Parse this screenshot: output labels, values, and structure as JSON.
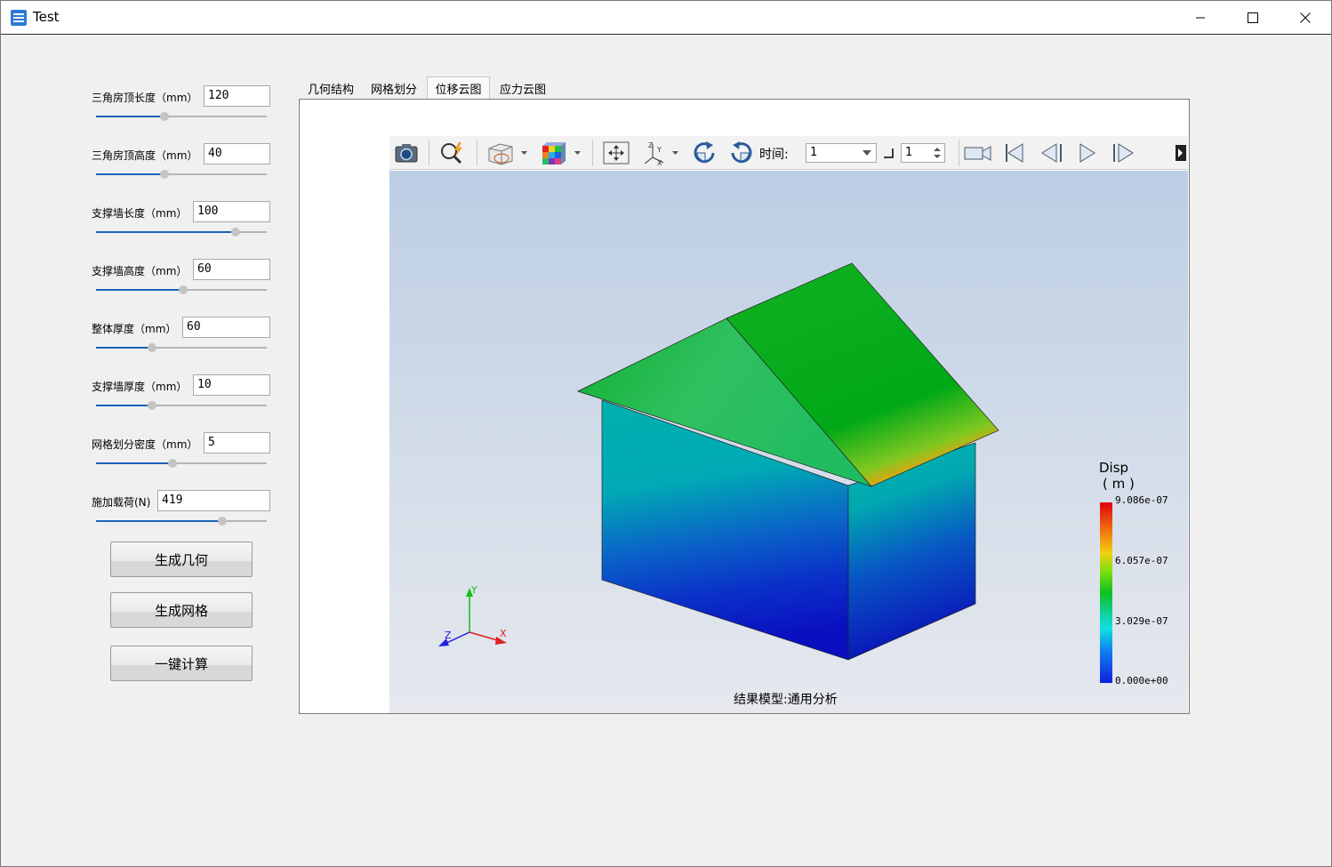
{
  "window": {
    "title": "Test",
    "minimize_icon": "minimize-icon",
    "maximize_icon": "maximize-icon",
    "close_icon": "close-icon"
  },
  "params": [
    {
      "label": "三角房顶长度（mm）",
      "value": "120",
      "slider_fraction": 0.4
    },
    {
      "label": "三角房顶高度（mm）",
      "value": "40",
      "slider_fraction": 0.4
    },
    {
      "label": "支撑墙长度（mm）",
      "value": "100",
      "slider_fraction": 0.82
    },
    {
      "label": "支撑墙高度（mm）",
      "value": "60",
      "slider_fraction": 0.51
    },
    {
      "label": "整体厚度（mm）",
      "value": "60",
      "slider_fraction": 0.33
    },
    {
      "label": "支撑墙厚度（mm）",
      "value": "10",
      "slider_fraction": 0.33
    },
    {
      "label": "网格划分密度（mm）",
      "value": "5",
      "slider_fraction": 0.45
    },
    {
      "label": "施加载荷(N)",
      "value": "419",
      "slider_fraction": 0.74
    }
  ],
  "buttons": {
    "generate_geometry": "生成几何",
    "generate_mesh": "生成网格",
    "one_click_compute": "一键计算"
  },
  "tabs": [
    {
      "label": "几何结构",
      "active": false
    },
    {
      "label": "网格划分",
      "active": false
    },
    {
      "label": "位移云图",
      "active": true
    },
    {
      "label": "应力云图",
      "active": false
    }
  ],
  "toolbar": {
    "time_label": "时间:",
    "time_value": "1",
    "step_value": "1",
    "icons": [
      "camera-icon",
      "zoom-icon",
      "display-mode-icon",
      "color-cube-icon",
      "fit-view-icon",
      "axes-icon",
      "rotate-cw-icon",
      "rotate-ccw-icon",
      "record-icon",
      "first-frame-icon",
      "previous-frame-icon",
      "play-icon",
      "next-frame-icon"
    ]
  },
  "legend": {
    "title_line1": "Disp",
    "title_line2": "( m )",
    "ticks": [
      "9.086e-07",
      "6.057e-07",
      "3.029e-07",
      "0.000e+00"
    ]
  },
  "axes": {
    "x": "X",
    "y": "Y",
    "z": "Z"
  },
  "caption": "结果模型:通用分析",
  "colors": {
    "accent": "#1d62b8",
    "viewport_top": "#bccde4",
    "viewport_bottom": "#e6e8ee"
  }
}
